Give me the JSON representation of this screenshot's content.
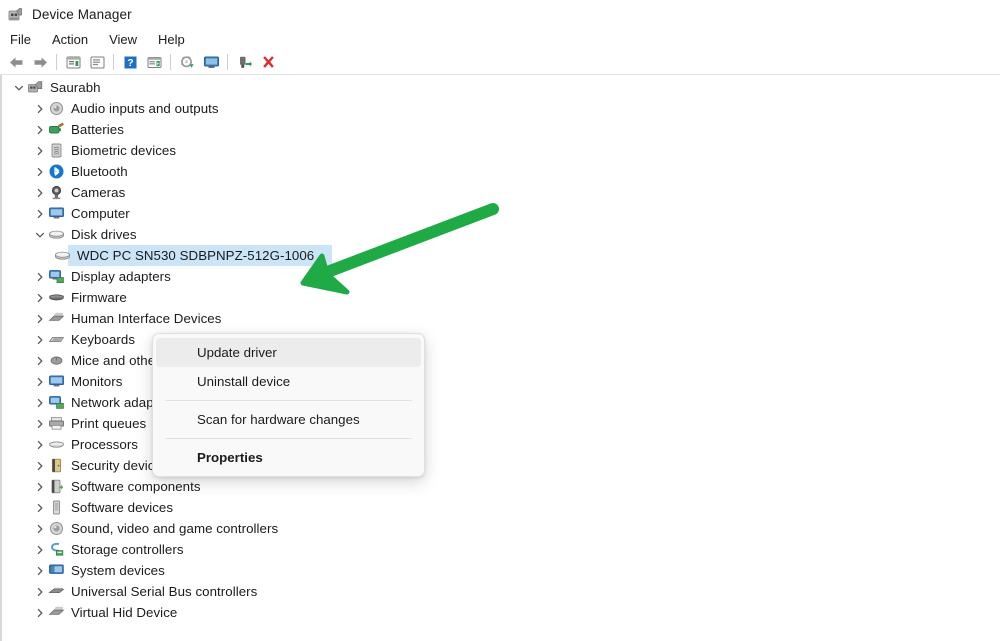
{
  "window": {
    "title": "Device Manager",
    "icon": "device-manager-icon"
  },
  "menubar": {
    "items": [
      {
        "label": "File"
      },
      {
        "label": "Action"
      },
      {
        "label": "View"
      },
      {
        "label": "Help"
      }
    ]
  },
  "toolbar": {
    "buttons": [
      {
        "name": "back-arrow-icon"
      },
      {
        "name": "forward-arrow-icon"
      },
      {
        "name": "separator"
      },
      {
        "name": "properties-icon"
      },
      {
        "name": "update-driver-software-icon"
      },
      {
        "name": "separator"
      },
      {
        "name": "help-icon"
      },
      {
        "name": "device-view-icon"
      },
      {
        "name": "separator"
      },
      {
        "name": "scan-for-hardware-changes-icon"
      },
      {
        "name": "show-hidden-devices-icon"
      },
      {
        "name": "separator"
      },
      {
        "name": "enable-device-icon"
      },
      {
        "name": "uninstall-device-icon"
      }
    ]
  },
  "tree": {
    "root": {
      "label": "Saurabh",
      "icon": "computer-node-icon",
      "expanded": true
    },
    "items": [
      {
        "label": "Audio inputs and outputs",
        "icon": "speaker-icon",
        "expanded": false
      },
      {
        "label": "Batteries",
        "icon": "battery-icon",
        "expanded": false
      },
      {
        "label": "Biometric devices",
        "icon": "fingerprint-icon",
        "expanded": false
      },
      {
        "label": "Bluetooth",
        "icon": "bluetooth-icon",
        "expanded": false
      },
      {
        "label": "Cameras",
        "icon": "camera-icon",
        "expanded": false
      },
      {
        "label": "Computer",
        "icon": "monitor-icon",
        "expanded": false
      },
      {
        "label": "Disk drives",
        "icon": "disk-drive-icon",
        "expanded": true
      },
      {
        "label": "Display adapters",
        "icon": "display-adapter-icon",
        "expanded": false
      },
      {
        "label": "Firmware",
        "icon": "firmware-icon",
        "expanded": false
      },
      {
        "label": "Human Interface Devices",
        "icon": "hid-icon",
        "expanded": false
      },
      {
        "label": "Keyboards",
        "icon": "keyboard-icon",
        "expanded": false
      },
      {
        "label": "Mice and other pointing devices",
        "icon": "mouse-icon",
        "expanded": false
      },
      {
        "label": "Monitors",
        "icon": "monitor-icon",
        "expanded": false
      },
      {
        "label": "Network adapters",
        "icon": "network-adapter-icon",
        "expanded": false
      },
      {
        "label": "Print queues",
        "icon": "printer-icon",
        "expanded": false
      },
      {
        "label": "Processors",
        "icon": "processor-icon",
        "expanded": false
      },
      {
        "label": "Security devices",
        "icon": "security-device-icon",
        "expanded": false
      },
      {
        "label": "Software components",
        "icon": "software-component-icon",
        "expanded": false
      },
      {
        "label": "Software devices",
        "icon": "software-device-icon",
        "expanded": false
      },
      {
        "label": "Sound, video and game controllers",
        "icon": "speaker-icon",
        "expanded": false
      },
      {
        "label": "Storage controllers",
        "icon": "storage-controller-icon",
        "expanded": false
      },
      {
        "label": "System devices",
        "icon": "system-device-icon",
        "expanded": false
      },
      {
        "label": "Universal Serial Bus controllers",
        "icon": "usb-icon",
        "expanded": false
      },
      {
        "label": "Virtual Hid Device",
        "icon": "hid-icon",
        "expanded": false
      }
    ],
    "selected_device": {
      "label": "WDC PC SN530 SDBPNPZ-512G-1006",
      "icon": "disk-drive-icon",
      "selected": true
    }
  },
  "context_menu": {
    "items": [
      {
        "label": "Update driver",
        "highlighted": true,
        "bold": false
      },
      {
        "label": "Uninstall device",
        "highlighted": false,
        "bold": false
      },
      {
        "separator": true
      },
      {
        "label": "Scan for hardware changes",
        "highlighted": false,
        "bold": false
      },
      {
        "separator": true
      },
      {
        "label": "Properties",
        "highlighted": false,
        "bold": true
      }
    ]
  },
  "annotation": {
    "arrow": {
      "name": "green-pointer-arrow",
      "color": "#1faa45",
      "points_to": "Update driver"
    }
  },
  "colors": {
    "selection": "#cce4f7",
    "menu_highlight": "#ececec",
    "annotation_green": "#1faa45",
    "window_background": "#ffffff"
  }
}
